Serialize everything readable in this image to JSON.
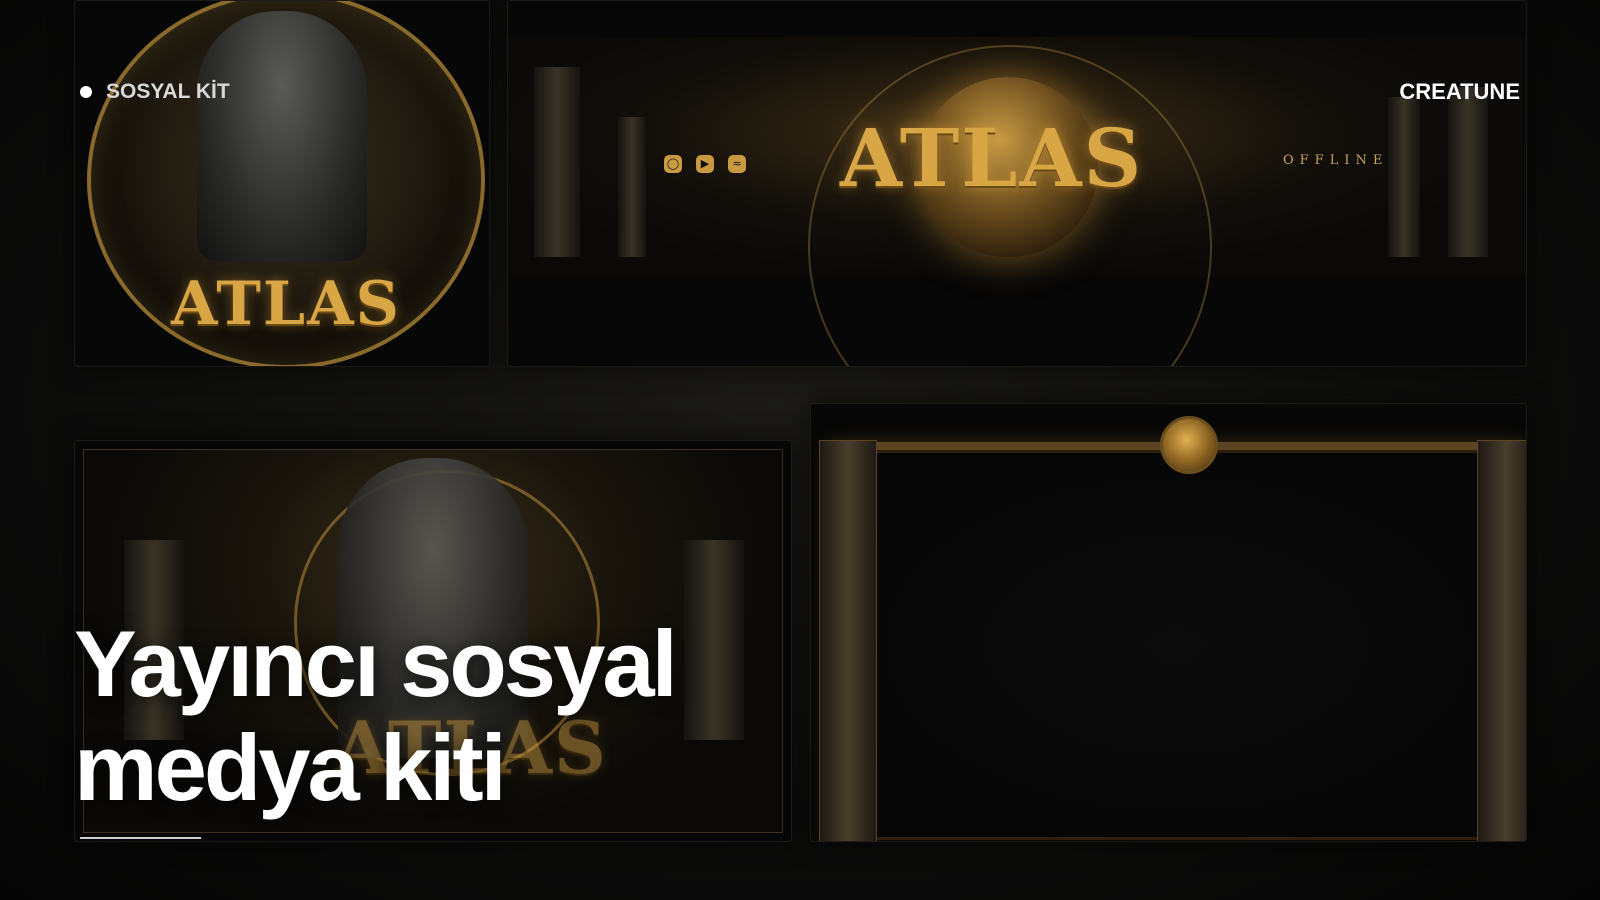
{
  "tag": {
    "label": "SOSYAL KİT"
  },
  "brand": {
    "label": "CREATUNE"
  },
  "headline": {
    "line1": "Yayıncı sosyal",
    "line2": "medya kiti"
  },
  "avatar_panel": {
    "logo_text": "ATLAS"
  },
  "banner_panel": {
    "logo_text": "ATLAS",
    "status_text": "OFFLINE",
    "social_icons": [
      "instagram-icon",
      "youtube-icon",
      "spotify-icon"
    ]
  },
  "screen_panel": {
    "logo_text": "ATLAS"
  },
  "colors": {
    "accent_gold": "#d9a646",
    "background": "#0d0d0c",
    "text": "#ffffff"
  }
}
